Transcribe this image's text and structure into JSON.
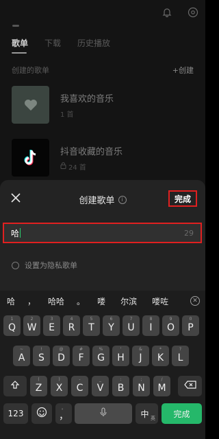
{
  "tabs": [
    "歌单",
    "下载",
    "历史播放"
  ],
  "section": {
    "title": "创建的歌单",
    "create_label": "+创建"
  },
  "playlists": [
    {
      "title": "我喜欢的音乐",
      "count": "1 首"
    },
    {
      "title": "抖音收藏的音乐",
      "count": "24 首"
    }
  ],
  "sheet": {
    "title": "创建歌单",
    "done_label": "完成",
    "input_value": "哈",
    "char_remaining": "29",
    "private_label": "设置为隐私歌单"
  },
  "keyboard": {
    "suggestions": [
      "哈",
      "，",
      "哈哈",
      "。",
      "喽",
      "尔滨",
      "喽咗"
    ],
    "row1": [
      {
        "k": "Q",
        "s": "1"
      },
      {
        "k": "W",
        "s": "2"
      },
      {
        "k": "E",
        "s": "3"
      },
      {
        "k": "R",
        "s": "4"
      },
      {
        "k": "T",
        "s": "5"
      },
      {
        "k": "Y",
        "s": "6"
      },
      {
        "k": "U",
        "s": "7"
      },
      {
        "k": "I",
        "s": "8"
      },
      {
        "k": "O",
        "s": "9"
      },
      {
        "k": "P",
        "s": "0"
      }
    ],
    "row2": [
      {
        "k": "A",
        "s": "~"
      },
      {
        "k": "S",
        "s": "!"
      },
      {
        "k": "D",
        "s": "@"
      },
      {
        "k": "F",
        "s": "#"
      },
      {
        "k": "G",
        "s": "%"
      },
      {
        "k": "H",
        "s": "'"
      },
      {
        "k": "J",
        "s": "&"
      },
      {
        "k": "K",
        "s": "*"
      },
      {
        "k": "L",
        "s": "?"
      }
    ],
    "row3": [
      {
        "k": "Z",
        "s": "("
      },
      {
        "k": "X",
        "s": ")"
      },
      {
        "k": "C",
        "s": "-"
      },
      {
        "k": "V",
        "s": "_"
      },
      {
        "k": "B",
        "s": ":"
      },
      {
        "k": "N",
        "s": ";"
      },
      {
        "k": "M",
        "s": "/"
      }
    ],
    "num_label": "123",
    "comma_label": "，",
    "comma_sup": "。",
    "lang_label": "中",
    "lang_sup": "英",
    "enter_label": "完成"
  },
  "colors": {
    "accent_green": "#25b86a",
    "highlight_red": "#e02020"
  }
}
